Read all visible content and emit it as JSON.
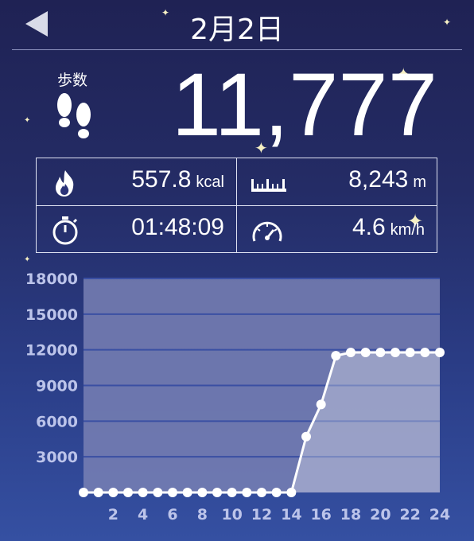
{
  "header": {
    "title": "2月2日"
  },
  "steps": {
    "label": "歩数",
    "value": "11,777"
  },
  "stats": {
    "calories": {
      "value": "557.8",
      "unit": "kcal"
    },
    "distance": {
      "value": "8,243",
      "unit": "m"
    },
    "duration": {
      "value": "01:48:09",
      "unit": ""
    },
    "speed": {
      "value": "4.6",
      "unit": "km/h"
    }
  },
  "icons": [
    "back-arrow-icon",
    "footprints-icon",
    "flame-icon",
    "ruler-icon",
    "stopwatch-icon",
    "speedometer-icon"
  ],
  "colors": {
    "line": "#ffffff",
    "grid": "#3a4fa3",
    "fill": "#ffffff",
    "axis_label": "#bcc4ea"
  },
  "chart_data": {
    "type": "line",
    "xlabel": "",
    "ylabel": "",
    "xlim": [
      0,
      24
    ],
    "ylim": [
      0,
      18000
    ],
    "yticks": [
      "18000",
      "15000",
      "12000",
      "9000",
      "6000",
      "3000"
    ],
    "ytick_values": [
      18000,
      15000,
      12000,
      9000,
      6000,
      3000
    ],
    "xticks": [
      "2",
      "4",
      "6",
      "8",
      "10",
      "12",
      "14",
      "16",
      "18",
      "20",
      "22",
      "24"
    ],
    "xtick_values": [
      2,
      4,
      6,
      8,
      10,
      12,
      14,
      16,
      18,
      20,
      22,
      24
    ],
    "grid": true,
    "x": [
      0,
      1,
      2,
      3,
      4,
      5,
      6,
      7,
      8,
      9,
      10,
      11,
      12,
      13,
      14,
      15,
      16,
      17,
      18,
      19,
      20,
      21,
      22,
      23,
      24
    ],
    "values": [
      0,
      0,
      0,
      0,
      0,
      0,
      0,
      0,
      0,
      0,
      0,
      0,
      0,
      0,
      0,
      4700,
      7400,
      11500,
      11777,
      11777,
      11777,
      11777,
      11777,
      11777,
      11777
    ]
  }
}
